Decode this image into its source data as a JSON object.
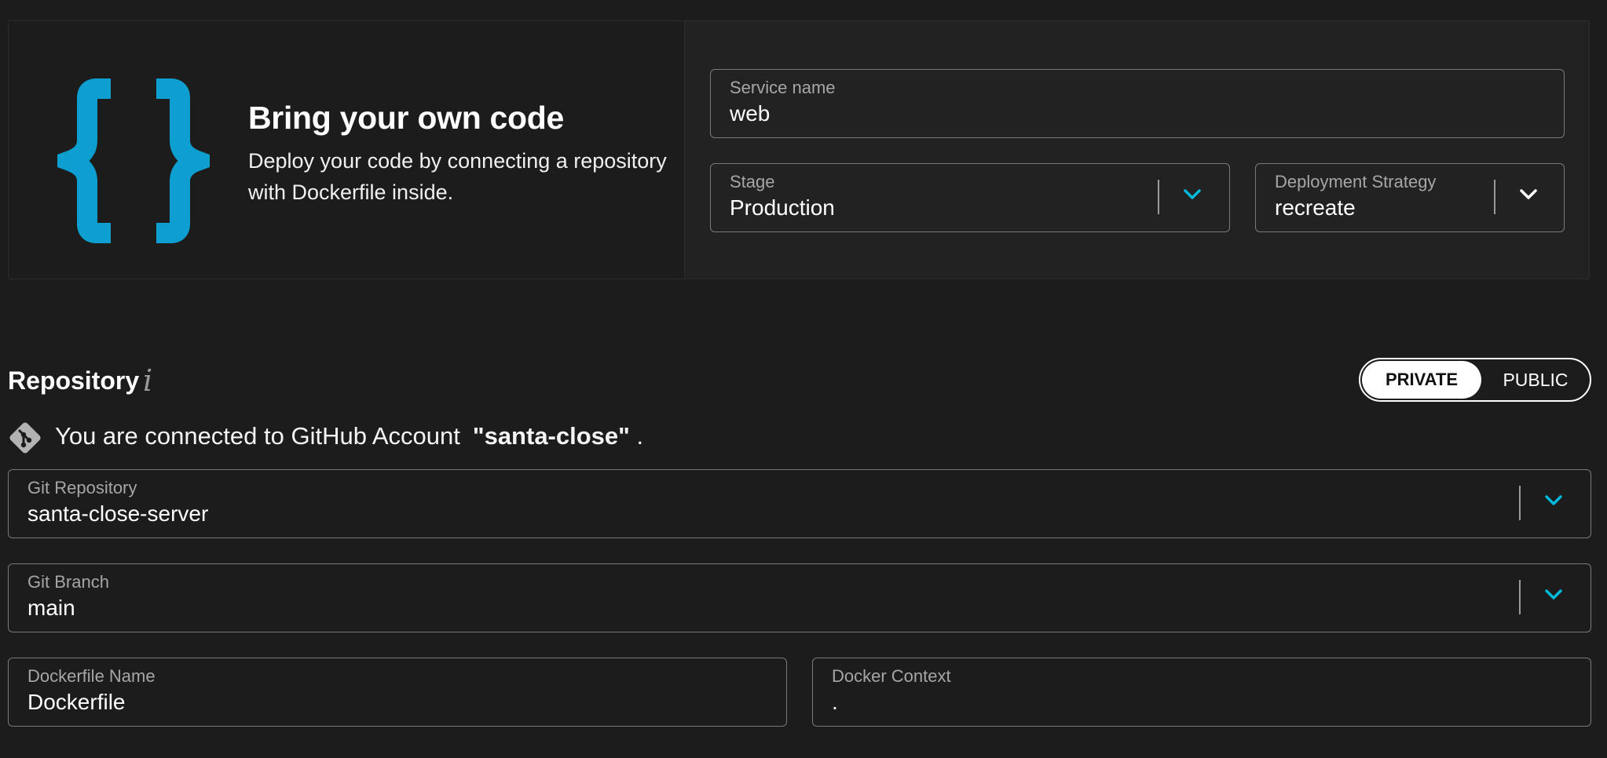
{
  "hero": {
    "title": "Bring your own code",
    "description": "Deploy your code by connecting a repository with Dockerfile inside.",
    "logo_icon": "curly-braces-icon"
  },
  "service": {
    "name_label": "Service name",
    "name_value": "web"
  },
  "stage": {
    "label": "Stage",
    "value": "Production"
  },
  "deployment_strategy": {
    "label": "Deployment Strategy",
    "value": "recreate"
  },
  "repository": {
    "title": "Repository",
    "info_icon": "i",
    "toggle": {
      "private_label": "PRIVATE",
      "public_label": "PUBLIC",
      "selected": "PRIVATE"
    },
    "connected_text": "You are connected to GitHub Account",
    "account": "\"santa-close\"",
    "period": "."
  },
  "git_repository": {
    "label": "Git Repository",
    "value": "santa-close-server"
  },
  "git_branch": {
    "label": "Git Branch",
    "value": "main"
  },
  "dockerfile": {
    "label": "Dockerfile Name",
    "value": "Dockerfile"
  },
  "docker_context": {
    "label": "Docker Context",
    "value": "."
  },
  "colors": {
    "accent": "#00b8d9",
    "logo": "#0c9fd0",
    "background": "#1c1c1c",
    "panel": "#222222",
    "field_border": "#7a7a7a"
  }
}
